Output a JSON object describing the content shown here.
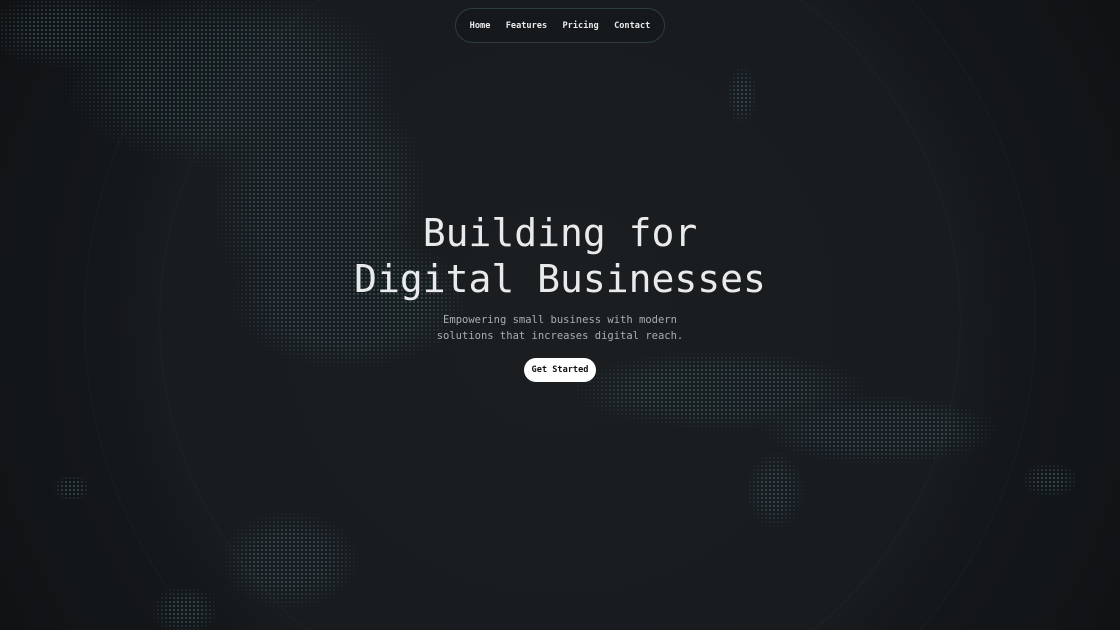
{
  "nav": {
    "items": [
      {
        "label": "Home"
      },
      {
        "label": "Features"
      },
      {
        "label": "Pricing"
      },
      {
        "label": "Contact"
      }
    ]
  },
  "hero": {
    "title_line1": "Building for",
    "title_line2": "Digital Businesses",
    "subtitle_line1": "Empowering small business with modern",
    "subtitle_line2": "solutions that increases digital reach.",
    "cta_label": "Get Started"
  },
  "colors": {
    "background": "#111416",
    "dots": "#3b5a60",
    "nav_border": "#2c3c40",
    "cta": "#ffffff"
  }
}
